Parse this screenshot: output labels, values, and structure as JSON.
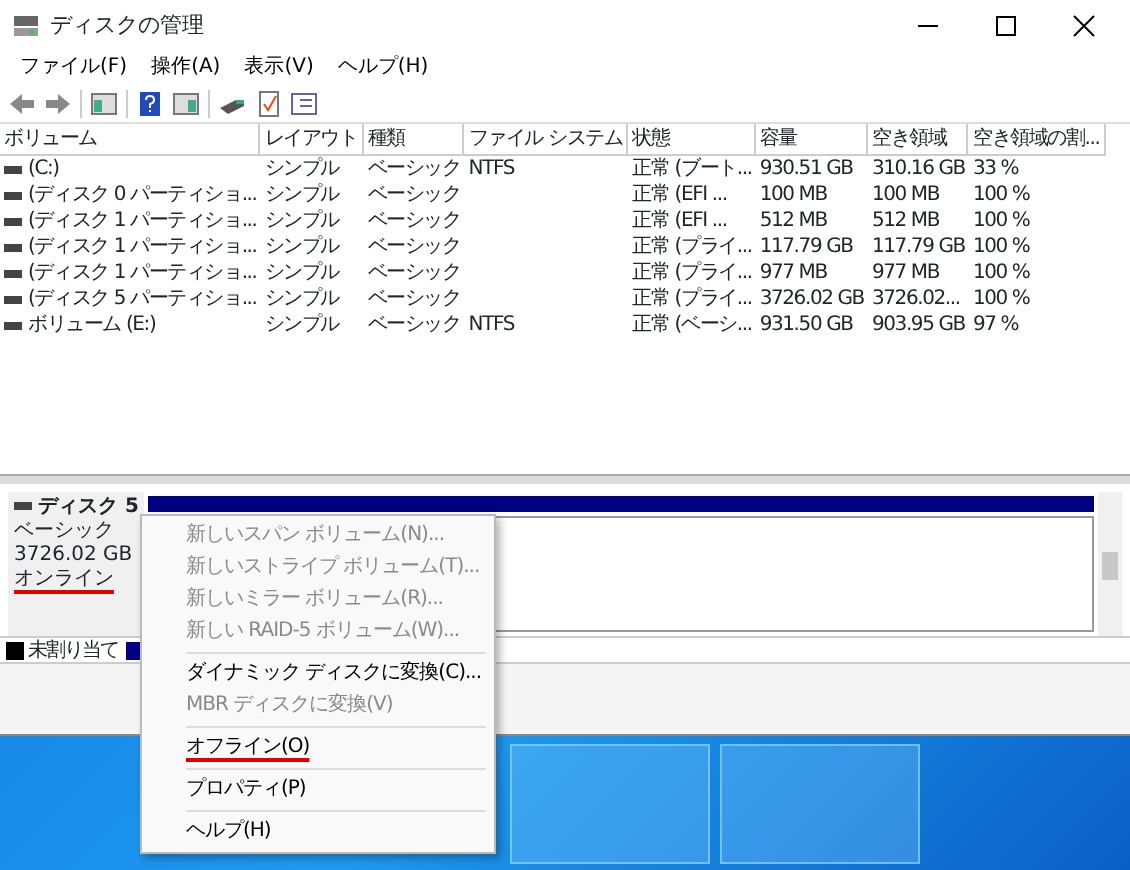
{
  "window": {
    "title": "ディスクの管理"
  },
  "menu_bar": [
    "ファイル(F)",
    "操作(A)",
    "表示(V)",
    "ヘルプ(H)"
  ],
  "table": {
    "columns": [
      "ボリューム",
      "レイアウト",
      "種類",
      "ファイル システム",
      "状態",
      "容量",
      "空き領域",
      "空き領域の割..."
    ],
    "rows": [
      [
        "(C:)",
        "シンプル",
        "ベーシック",
        "NTFS",
        "正常 (ブート...",
        "930.51 GB",
        "310.16 GB",
        "33 %"
      ],
      [
        "(ディスク 0 パーティショ...",
        "シンプル",
        "ベーシック",
        "",
        "正常 (EFI ...",
        "100 MB",
        "100 MB",
        "100 %"
      ],
      [
        "(ディスク 1 パーティショ...",
        "シンプル",
        "ベーシック",
        "",
        "正常 (EFI ...",
        "512 MB",
        "512 MB",
        "100 %"
      ],
      [
        "(ディスク 1 パーティショ...",
        "シンプル",
        "ベーシック",
        "",
        "正常 (プライ...",
        "117.79 GB",
        "117.79 GB",
        "100 %"
      ],
      [
        "(ディスク 1 パーティショ...",
        "シンプル",
        "ベーシック",
        "",
        "正常 (プライ...",
        "977 MB",
        "977 MB",
        "100 %"
      ],
      [
        "(ディスク 5 パーティショ...",
        "シンプル",
        "ベーシック",
        "",
        "正常 (プライ...",
        "3726.02 GB",
        "3726.02...",
        "100 %"
      ],
      [
        "ボリューム (E:)",
        "シンプル",
        "ベーシック",
        "NTFS",
        "正常 (ベーシ...",
        "931.50 GB",
        "903.95 GB",
        "97 %"
      ]
    ]
  },
  "disk": {
    "name": "ディスク 5",
    "type": "ベーシック",
    "size": "3726.02 GB",
    "status": "オンライン",
    "status_underlined": true
  },
  "legend": [
    {
      "label": "未割り当て",
      "color": "#000000"
    },
    {
      "color": "#000080"
    }
  ],
  "context_menu": [
    {
      "kind": "item",
      "label": "新しいスパン ボリューム(N)...",
      "disabled": true,
      "underlined": false
    },
    {
      "kind": "item",
      "label": "新しいストライプ ボリューム(T)...",
      "disabled": true,
      "underlined": false
    },
    {
      "kind": "item",
      "label": "新しいミラー ボリューム(R)...",
      "disabled": true,
      "underlined": false
    },
    {
      "kind": "item",
      "label": "新しい RAID-5 ボリューム(W)...",
      "disabled": true,
      "underlined": false
    },
    {
      "kind": "separator"
    },
    {
      "kind": "item",
      "label": "ダイナミック ディスクに変換(C)...",
      "disabled": false,
      "underlined": false
    },
    {
      "kind": "item",
      "label": "MBR ディスクに変換(V)",
      "disabled": true,
      "underlined": false
    },
    {
      "kind": "separator"
    },
    {
      "kind": "item",
      "label": "オフライン(O)",
      "disabled": false,
      "underlined": true
    },
    {
      "kind": "separator"
    },
    {
      "kind": "item",
      "label": "プロパティ(P)",
      "disabled": false,
      "underlined": false
    },
    {
      "kind": "separator"
    },
    {
      "kind": "item",
      "label": "ヘルプ(H)",
      "disabled": false,
      "underlined": false
    }
  ]
}
